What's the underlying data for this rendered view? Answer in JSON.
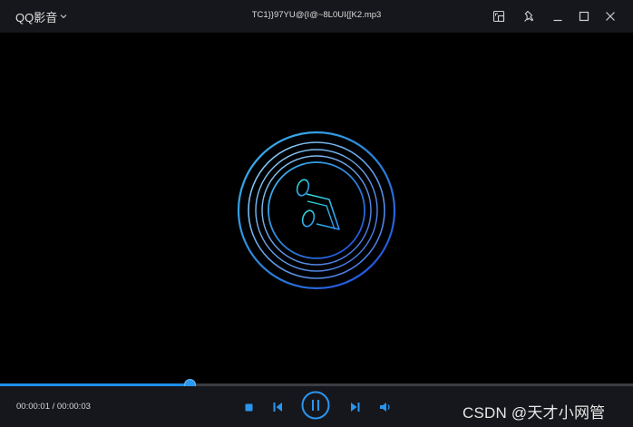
{
  "app": {
    "menu_label": "QQ影音",
    "file_title": "TC1}}97YU@{I@~8L0UI{[K2.mp3"
  },
  "titlebar_icons": [
    "screenshot-icon",
    "pin-icon",
    "minimize-icon",
    "maximize-icon",
    "close-icon"
  ],
  "playback": {
    "current_time": "00:00:01",
    "separator": " / ",
    "total_time": "00:00:03",
    "progress": 0.3
  },
  "controls": [
    "stop-icon",
    "previous-icon",
    "pause-icon",
    "next-icon",
    "volume-icon"
  ],
  "watermark": "CSDN @天才小网管",
  "colors": {
    "accent": "#1f8fea",
    "titlebar_bg": "#16171c",
    "stage_bg": "#000000"
  }
}
